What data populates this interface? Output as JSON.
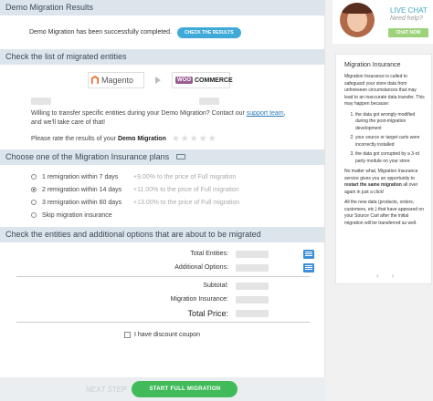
{
  "results": {
    "header": "Demo Migration Results",
    "message": "Demo Migration has been successfully completed.",
    "check_button": "CHECK THE RESULTS"
  },
  "entities_section": {
    "header": "Check the list of migrated entities",
    "source_logo": "Magento",
    "target_logo_brand": "WOO",
    "target_logo_text": "COMMERCE",
    "transfer_text": "Willing to transfer specific entities during your Demo Migration? Contact our",
    "support_link": "support team",
    "transfer_text_end": ", and we'll take care of that!",
    "rate_prefix": "Please rate the results of your",
    "rate_bold": "Demo Migration",
    "stars": "★★★★★"
  },
  "insurance_section": {
    "header": "Choose one of the Migration Insurance plans",
    "plans": [
      {
        "label": "1 remigration within 7 days",
        "price": "+9.00% to the price of Full migration",
        "selected": false
      },
      {
        "label": "2 remigration within 14 days",
        "price": "+11.00% to the price of Full migration",
        "selected": true
      },
      {
        "label": "3 remigration within 60 days",
        "price": "+13.00% to the price of Full migration",
        "selected": false
      },
      {
        "label": "Skip migration insurance",
        "price": "",
        "selected": false
      }
    ]
  },
  "options_section": {
    "header": "Check the entities and additional options that are about to be migrated",
    "rows": {
      "total_entities": "Total Entities:",
      "additional_options": "Additional Options:",
      "subtotal": "Subtotal:",
      "migration_insurance": "Migration Insurance:",
      "total_price": "Total Price:"
    },
    "coupon_label": "I have discount coupon"
  },
  "footer": {
    "next_step": "NEXT STEP",
    "start_button": "START FULL MIGRATION"
  },
  "side": {
    "live_chat": "LIVE CHAT",
    "need_help": "Need help?",
    "chat_now": "CHAT NOW",
    "card_title": "Migration Insurance",
    "p1": "Migration Insurance is called to safeguard your store data from unforeseen circumstances that may lead to an inaccurate data transfer. This may happen because:",
    "list": [
      "the data got wrongly modified during the post-migration development",
      "your source or target carts were incorrectly installed",
      "the data got corrupted by a 3-rd party module on your store"
    ],
    "p2_start": "No matter what, Migration Insurance service gives you an opportunity to",
    "p2_bold": "restart the same migration",
    "p2_end": "all over again in just a click!",
    "p3": "All the new data (products, orders, customers, etc.) that have appeared on your Source Cart after the initial migration will be transferred as well.",
    "prev_arrow": "‹",
    "next_arrow": "›"
  },
  "colors": {
    "section_header_bg": "#dce5ec",
    "accent_blue": "#3fa9d8",
    "start_green": "#41bb5a",
    "chat_green": "#9cd27a"
  }
}
